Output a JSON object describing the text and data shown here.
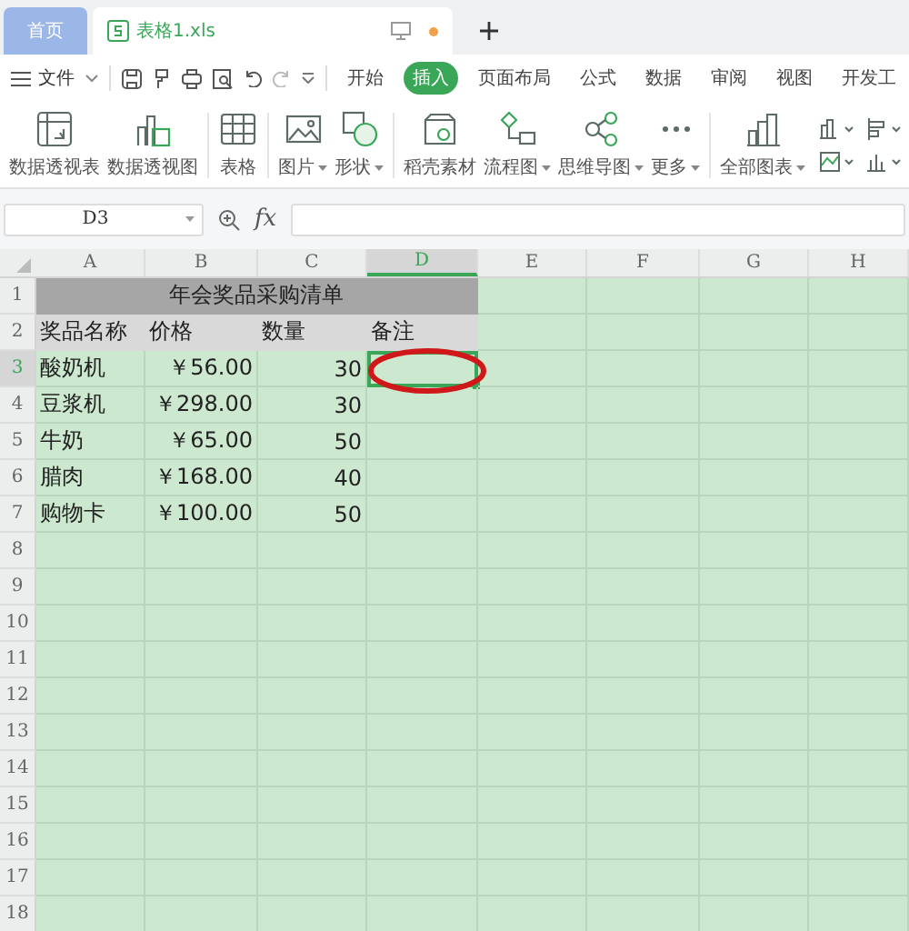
{
  "tabs": [
    {
      "label": "首页",
      "selected": false,
      "kind": "home"
    },
    {
      "label": "表格1.xls",
      "selected": true,
      "kind": "file",
      "modified": true
    }
  ],
  "menu": {
    "file_label": "文件"
  },
  "ribbon_tabs": [
    {
      "label": "开始",
      "selected": false
    },
    {
      "label": "插入",
      "selected": true
    },
    {
      "label": "页面布局",
      "selected": false
    },
    {
      "label": "公式",
      "selected": false
    },
    {
      "label": "数据",
      "selected": false
    },
    {
      "label": "审阅",
      "selected": false
    },
    {
      "label": "视图",
      "selected": false
    },
    {
      "label": "开发工",
      "selected": false
    }
  ],
  "ribbon_items": [
    {
      "label": "数据透视表",
      "kind": "pivot-table",
      "dropdown": false,
      "divider_after": false
    },
    {
      "label": "数据透视图",
      "kind": "pivot-chart",
      "dropdown": false,
      "divider_after": true
    },
    {
      "label": "表格",
      "kind": "table",
      "dropdown": false,
      "divider_after": true
    },
    {
      "label": "图片",
      "kind": "image",
      "dropdown": true,
      "divider_after": false
    },
    {
      "label": "形状",
      "kind": "shape",
      "dropdown": true,
      "divider_after": true
    },
    {
      "label": "稻壳素材",
      "kind": "material",
      "dropdown": false,
      "divider_after": false
    },
    {
      "label": "流程图",
      "kind": "flowchart",
      "dropdown": true,
      "divider_after": false
    },
    {
      "label": "思维导图",
      "kind": "mindmap",
      "dropdown": true,
      "divider_after": false
    },
    {
      "label": "更多",
      "kind": "more",
      "dropdown": true,
      "divider_after": true
    },
    {
      "label": "全部图表",
      "kind": "chart",
      "dropdown": true,
      "divider_after": false
    }
  ],
  "name_box": "D3",
  "formula_label": "fx",
  "columns": [
    {
      "label": "A",
      "selected": false
    },
    {
      "label": "B",
      "selected": false
    },
    {
      "label": "C",
      "selected": false
    },
    {
      "label": "D",
      "selected": true
    },
    {
      "label": "E",
      "selected": false
    },
    {
      "label": "F",
      "selected": false
    },
    {
      "label": "G",
      "selected": false
    },
    {
      "label": "H",
      "selected": false
    }
  ],
  "rows": [
    {
      "number": "1",
      "kind": "title",
      "selected": false,
      "cells": [
        "年会奖品采购清单"
      ]
    },
    {
      "number": "2",
      "kind": "header",
      "selected": false,
      "cells": [
        "奖品名称",
        "价格",
        "数量",
        "备注"
      ]
    },
    {
      "number": "3",
      "kind": "data",
      "selected": true,
      "cells": [
        "酸奶机",
        "￥56.00",
        "30",
        ""
      ]
    },
    {
      "number": "4",
      "kind": "data",
      "selected": false,
      "cells": [
        "豆浆机",
        "￥298.00",
        "30",
        ""
      ]
    },
    {
      "number": "5",
      "kind": "data",
      "selected": false,
      "cells": [
        "牛奶",
        "￥65.00",
        "50",
        ""
      ]
    },
    {
      "number": "6",
      "kind": "data",
      "selected": false,
      "cells": [
        "腊肉",
        "￥168.00",
        "40",
        ""
      ]
    },
    {
      "number": "7",
      "kind": "data",
      "selected": false,
      "cells": [
        "购物卡",
        "￥100.00",
        "50",
        ""
      ]
    },
    {
      "number": "8",
      "kind": "empty",
      "selected": false,
      "cells": []
    },
    {
      "number": "9",
      "kind": "empty",
      "selected": false,
      "cells": []
    },
    {
      "number": "10",
      "kind": "empty",
      "selected": false,
      "cells": []
    },
    {
      "number": "11",
      "kind": "empty",
      "selected": false,
      "cells": []
    },
    {
      "number": "12",
      "kind": "empty",
      "selected": false,
      "cells": []
    },
    {
      "number": "13",
      "kind": "empty",
      "selected": false,
      "cells": []
    },
    {
      "number": "14",
      "kind": "empty",
      "selected": false,
      "cells": []
    },
    {
      "number": "15",
      "kind": "empty",
      "selected": false,
      "cells": []
    },
    {
      "number": "16",
      "kind": "empty",
      "selected": false,
      "cells": []
    },
    {
      "number": "17",
      "kind": "empty",
      "selected": false,
      "cells": []
    },
    {
      "number": "18",
      "kind": "empty",
      "selected": false,
      "cells": []
    }
  ]
}
